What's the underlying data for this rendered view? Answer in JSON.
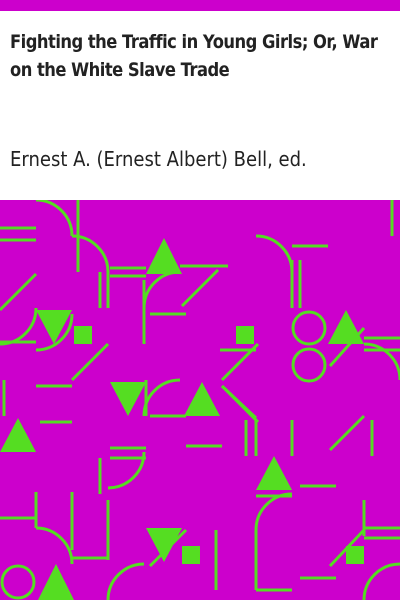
{
  "cover": {
    "title": "Fighting the Traffic in Young Girls; Or, War on the White Slave Trade",
    "author": "Ernest A. (Ernest Albert) Bell, ed."
  },
  "colors": {
    "background": "#ffffff",
    "accent": "#cc00cc",
    "pattern_bg": "#cc00cc",
    "pattern_fg": "#55dd22",
    "text": "#222222"
  }
}
